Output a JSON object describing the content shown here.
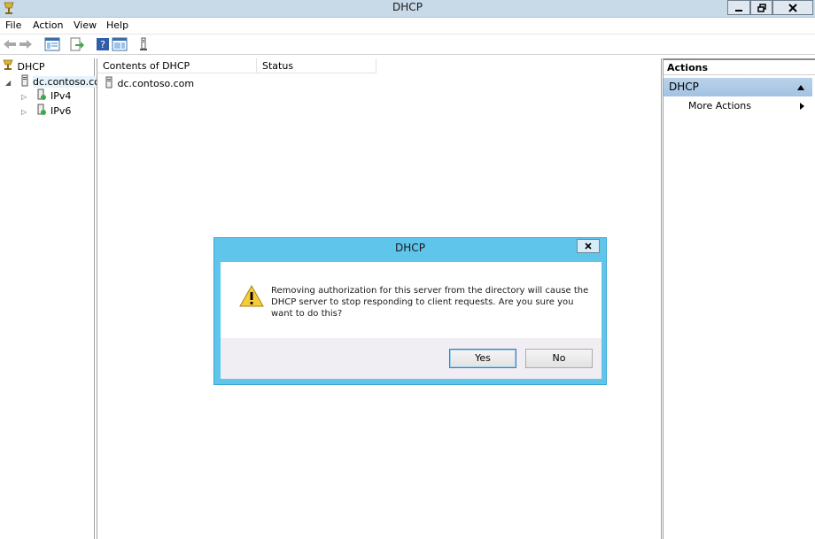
{
  "window": {
    "title": "DHCP"
  },
  "menu": [
    "File",
    "Action",
    "View",
    "Help"
  ],
  "tree": {
    "root": "DHCP",
    "server": "dc.contoso.co",
    "children": [
      "IPv4",
      "IPv6"
    ]
  },
  "content": {
    "columns": [
      "Contents of DHCP",
      "Status"
    ],
    "rows": [
      {
        "name": "dc.contoso.com",
        "status": ""
      }
    ]
  },
  "actions": {
    "header": "Actions",
    "section": "DHCP",
    "items": [
      "More Actions"
    ]
  },
  "dialog": {
    "title": "DHCP",
    "close": "x",
    "message": "Removing authorization for this server from the directory will cause the DHCP server to stop responding to client requests.  Are you sure you want to do this?",
    "yes": "Yes",
    "no": "No"
  }
}
